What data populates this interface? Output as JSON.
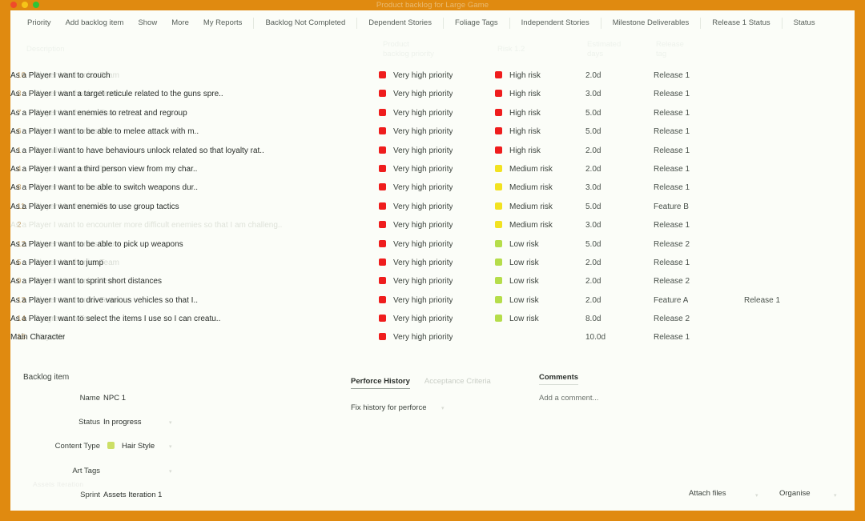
{
  "window": {
    "title": "Product backlog for Large Game",
    "frame_color": "#E08A10",
    "dots": [
      "close",
      "minimize",
      "zoom"
    ]
  },
  "toolbar": {
    "items": [
      "Priority",
      "Add backlog item",
      "Show",
      "More",
      "My Reports",
      "Backlog Not Completed",
      "Dependent Stories",
      "Foliage Tags",
      "Independent Stories",
      "Milestone Deliverables",
      "Release 1 Status",
      "Status"
    ]
  },
  "table": {
    "headers": {
      "description": "Description",
      "priority": "Product\nbacklog priority",
      "risk": "Risk 1.2",
      "days": "Estimated\ndays",
      "release": "Release\ntag"
    },
    "rows": [
      {
        "rank": "10",
        "team": "Player Mechanics Team",
        "description": "As a Player I want to crouch",
        "priority": "Very high priority",
        "priority_color": "#ef1d1d",
        "risk": "High risk",
        "risk_color": "#ef1d1d",
        "days": "2.0d",
        "release": "Release 1",
        "extra": "",
        "muted": false
      },
      {
        "rank": "3",
        "team": "Player Mechanics Team",
        "description": "As a Player I want a target reticule related to the guns spre..",
        "priority": "Very high priority",
        "priority_color": "#ef1d1d",
        "risk": "High risk",
        "risk_color": "#ef1d1d",
        "days": "3.0d",
        "release": "Release 1",
        "extra": "",
        "muted": false
      },
      {
        "rank": "7",
        "team": "Player Mechanics Team",
        "description": "As a Player I want enemies to retreat and regroup",
        "priority": "Very high priority",
        "priority_color": "#ef1d1d",
        "risk": "High risk",
        "risk_color": "#ef1d1d",
        "days": "5.0d",
        "release": "Release 1",
        "extra": "",
        "muted": false
      },
      {
        "rank": "6",
        "team": "Player Mechanics Team",
        "description": "As a Player I want to be able to melee attack with m..",
        "priority": "Very high priority",
        "priority_color": "#ef1d1d",
        "risk": "High risk",
        "risk_color": "#ef1d1d",
        "days": "5.0d",
        "release": "Release 1",
        "extra": "",
        "muted": false
      },
      {
        "rank": "1",
        "team": "Squad Team",
        "description": "As a Player I want to have behaviours unlock related so that loyalty rat..",
        "priority": "Very high priority",
        "priority_color": "#ef1d1d",
        "risk": "High risk",
        "risk_color": "#ef1d1d",
        "days": "2.0d",
        "release": "Release 1",
        "extra": "",
        "muted": false
      },
      {
        "rank": "4",
        "team": "Player Mechanics Team",
        "description": "As a Player I want a third person view from my char..",
        "priority": "Very high priority",
        "priority_color": "#ef1d1d",
        "risk": "Medium risk",
        "risk_color": "#f2e220",
        "days": "2.0d",
        "release": "Release 1",
        "extra": "",
        "muted": false
      },
      {
        "rank": "8",
        "team": "Player Mechanics Team",
        "description": "As a Player I want to be able to switch weapons dur..",
        "priority": "Very high priority",
        "priority_color": "#ef1d1d",
        "risk": "Medium risk",
        "risk_color": "#f2e220",
        "days": "3.0d",
        "release": "Release 1",
        "extra": "",
        "muted": false
      },
      {
        "rank": "11",
        "team": "Player Mechanics Team",
        "description": "As a Player I want enemies to use group tactics",
        "priority": "Very high priority",
        "priority_color": "#ef1d1d",
        "risk": "Medium risk",
        "risk_color": "#f2e220",
        "days": "5.0d",
        "release": "Feature B",
        "extra": "",
        "muted": false
      },
      {
        "rank": "2",
        "team": "",
        "description": "As a Player I want to encounter more difficult enemies so that I am challeng..",
        "priority": "Very high priority",
        "priority_color": "#ef1d1d",
        "risk": "Medium risk",
        "risk_color": "#f2e220",
        "days": "3.0d",
        "release": "Release 1",
        "extra": "",
        "muted": true
      },
      {
        "rank": "12",
        "team": "Player Mechanics Team",
        "description": "As a Player I want to be able to pick up weapons",
        "priority": "Very high priority",
        "priority_color": "#ef1d1d",
        "risk": "Low risk",
        "risk_color": "#b5dd4a",
        "days": "5.0d",
        "release": "Release 2",
        "extra": "",
        "muted": false
      },
      {
        "rank": "5",
        "team": "Player Mechanics Team",
        "description": "As a Player I want to jump",
        "priority": "Very high priority",
        "priority_color": "#ef1d1d",
        "risk": "Low risk",
        "risk_color": "#b5dd4a",
        "days": "2.0d",
        "release": "Release 1",
        "extra": "",
        "muted": false
      },
      {
        "rank": "9",
        "team": "Player Mechanics Team",
        "description": "As a Player I want to sprint short distances",
        "priority": "Very high priority",
        "priority_color": "#ef1d1d",
        "risk": "Low risk",
        "risk_color": "#b5dd4a",
        "days": "2.0d",
        "release": "Release 2",
        "extra": "",
        "muted": false
      },
      {
        "rank": "13",
        "team": "Player Mechanics Team",
        "description": "As a Player I want to drive various vehicles so that I..",
        "priority": "Very high priority",
        "priority_color": "#ef1d1d",
        "risk": "Low risk",
        "risk_color": "#b5dd4a",
        "days": "2.0d",
        "release": "Feature A",
        "extra": "Release 1",
        "muted": false
      },
      {
        "rank": "14",
        "team": "Progression Team",
        "description": "As a Player I want to select the items I use so I can creatu..",
        "priority": "Very high priority",
        "priority_color": "#ef1d1d",
        "risk": "Low risk",
        "risk_color": "#b5dd4a",
        "days": "8.0d",
        "release": "Release 2",
        "extra": "",
        "muted": false
      },
      {
        "rank": "15",
        "team": "Playable",
        "description": "Main Character",
        "priority": "Very high priority",
        "priority_color": "#ef1d1d",
        "risk": "",
        "risk_color": "",
        "days": "10.0d",
        "release": "Release 1",
        "extra": "",
        "muted": false
      }
    ]
  },
  "detail": {
    "title": "Backlog item",
    "fields": [
      {
        "label": "Name",
        "value": "NPC 1",
        "swatch": "",
        "caret": false
      },
      {
        "label": "Status",
        "value": "In progress",
        "swatch": "",
        "caret": true
      },
      {
        "label": "Content Type",
        "value": "Hair Style",
        "swatch": "#ccdf66",
        "caret": true
      },
      {
        "label": "Art Tags",
        "value": "",
        "swatch": "",
        "caret": true
      },
      {
        "label": "Sprint",
        "value": "Assets Iteration 1",
        "swatch": "",
        "caret": false
      }
    ],
    "ghost_label": "Assets Iteration",
    "history": {
      "tabs": [
        {
          "label": "Perforce History",
          "active": true
        },
        {
          "label": "Acceptance Criteria",
          "active": false
        }
      ],
      "body": "Fix history for perforce"
    },
    "comments": {
      "title": "Comments",
      "placeholder": "Add a comment..."
    },
    "actions": {
      "attach": "Attach files",
      "organise": "Organise"
    }
  }
}
